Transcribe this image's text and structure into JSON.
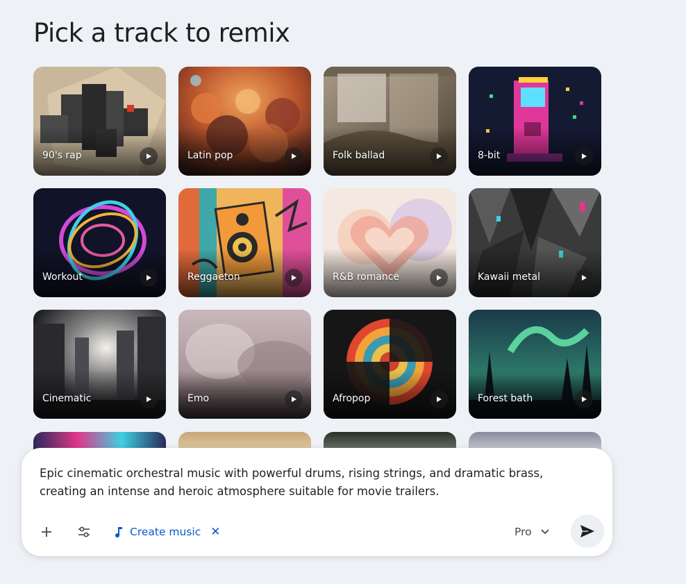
{
  "page": {
    "title": "Pick a track to remix"
  },
  "tracks": [
    {
      "label": "90's rap"
    },
    {
      "label": "Latin pop"
    },
    {
      "label": "Folk ballad"
    },
    {
      "label": "8-bit"
    },
    {
      "label": "Workout"
    },
    {
      "label": "Reggaeton"
    },
    {
      "label": "R&B romance"
    },
    {
      "label": "Kawaii metal"
    },
    {
      "label": "Cinematic"
    },
    {
      "label": "Emo"
    },
    {
      "label": "Afropop"
    },
    {
      "label": "Forest bath"
    }
  ],
  "composer": {
    "prompt": "Epic cinematic orchestral music with powerful drums, rising strings, and dramatic brass, creating an intense and heroic atmosphere suitable for movie trailers.",
    "chip_label": "Create music",
    "model_label": "Pro"
  },
  "icons": {
    "add": "plus-icon",
    "tools": "sliders-icon",
    "chip": "music-note-icon",
    "chip_close": "close-icon",
    "model": "chevron-down-icon",
    "send": "send-icon",
    "play": "play-icon"
  },
  "colors": {
    "accent": "#0b57d0",
    "background": "#eef1f6"
  }
}
